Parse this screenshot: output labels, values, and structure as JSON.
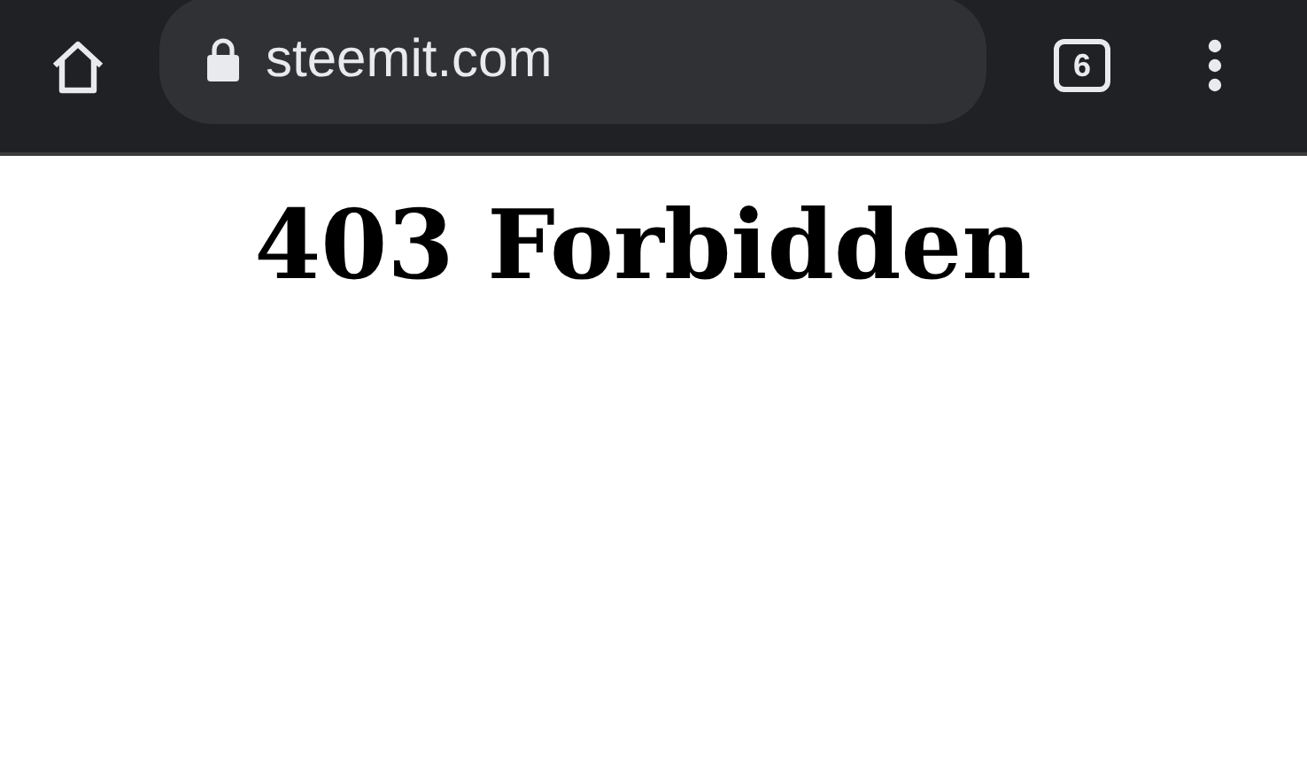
{
  "toolbar": {
    "url": "steemit.com",
    "tab_count": "6"
  },
  "page": {
    "heading": "403 Forbidden"
  }
}
